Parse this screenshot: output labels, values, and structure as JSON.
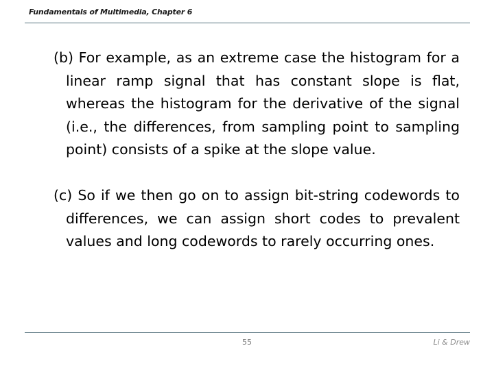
{
  "header": {
    "title": "Fundamentals of Multimedia, Chapter 6",
    "rule_color": "#54707c"
  },
  "body": {
    "paragraphs": [
      {
        "marker": "(b)",
        "text": "For example, as an extreme case the histogram for a linear ramp signal that has constant slope is flat, whereas the histogram for the derivative of the signal (i.e., the differences, from sampling point to sampling point) consists of a spike at the slope value."
      },
      {
        "marker": "(c)",
        "text": "So if we then go on to assign bit-string codewords to differences, we can assign short codes to prevalent values and long codewords to rarely occurring ones."
      }
    ]
  },
  "footer": {
    "page_number": "55",
    "attribution": "Li & Drew",
    "rule_color": "#54707c"
  }
}
